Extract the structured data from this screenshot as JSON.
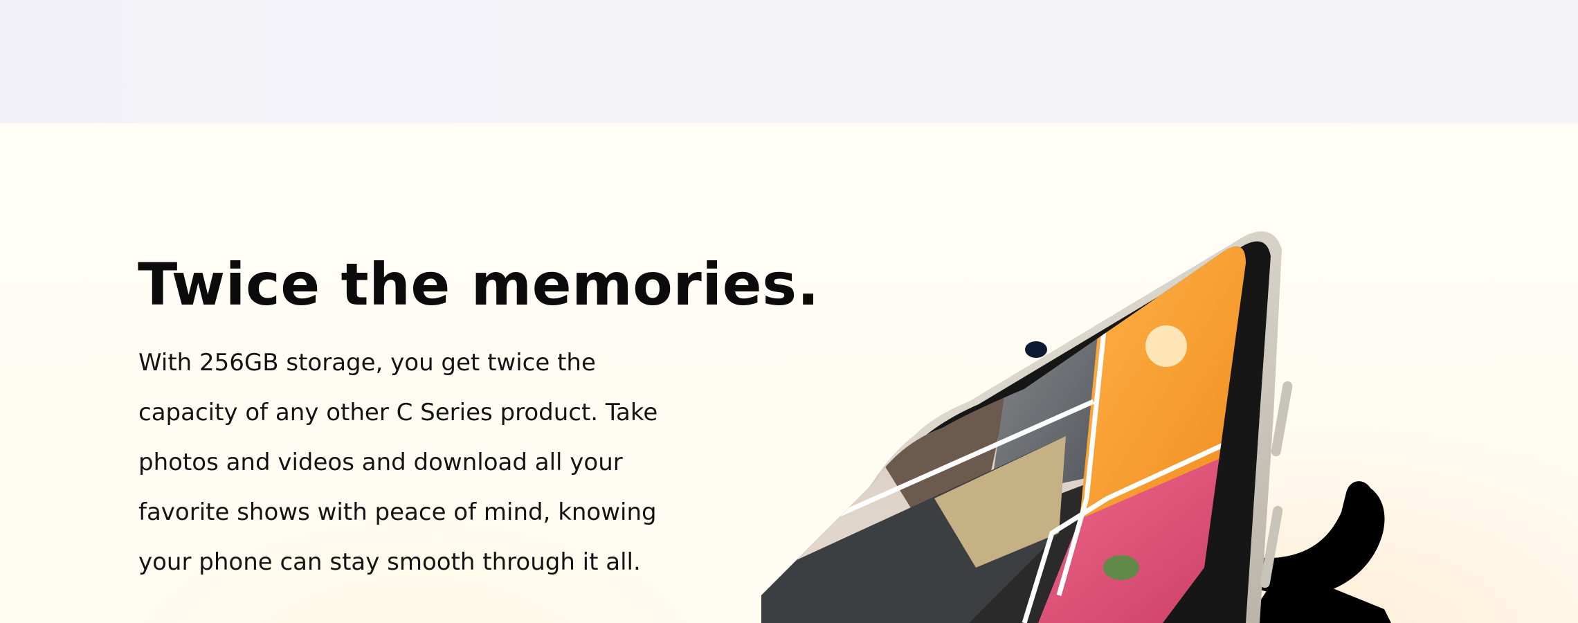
{
  "headline": "Twice the memories.",
  "body_lines": [
    "With 256GB storage, you get twice the",
    "capacity of any other C Series product. Take",
    "photos and videos and download all your",
    "favorite shows with peace of mind, knowing",
    "your phone can stay smooth through it all."
  ],
  "colors": {
    "top_band": "#f2f1f7",
    "section_bg": "#fffdf6",
    "text": "#0b0b0b"
  },
  "icons": [
    "phone-image",
    "number-2-graphic",
    "camera-lens-icon"
  ]
}
